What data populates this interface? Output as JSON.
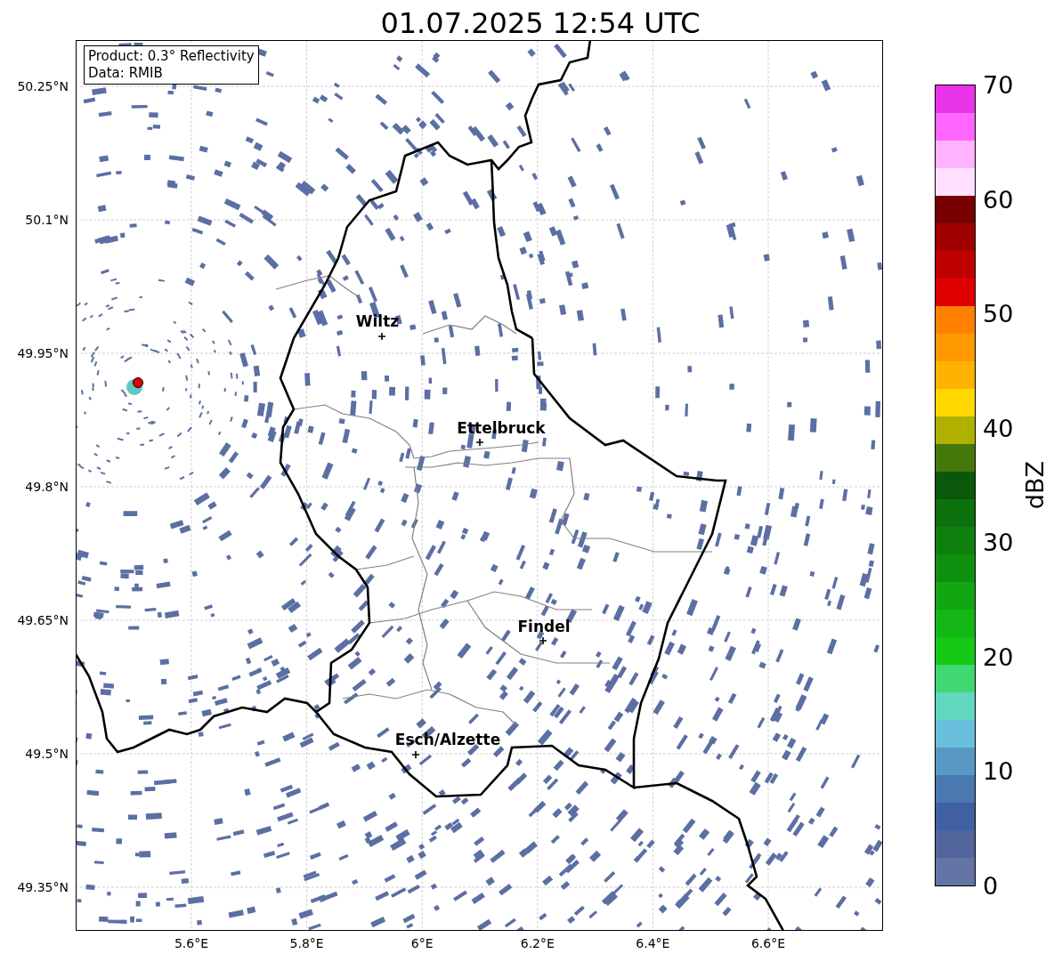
{
  "title": "01.07.2025 12:54 UTC",
  "map": {
    "info_box": [
      "Product: 0.3° Reflectivity",
      "Data: RMIB"
    ],
    "y_ticks": [
      "50.25°N",
      "50.1°N",
      "49.95°N",
      "49.8°N",
      "49.65°N",
      "49.5°N",
      "49.35°N"
    ],
    "x_ticks": [
      "5.6°E",
      "5.8°E",
      "6°E",
      "6.2°E",
      "6.4°E",
      "6.6°E"
    ],
    "places": [
      {
        "name": "Wiltz"
      },
      {
        "name": "Ettelbruck"
      },
      {
        "name": "Findel"
      },
      {
        "name": "Esch/Alzette"
      }
    ]
  },
  "colorbar": {
    "label": "dBZ",
    "ticks": [
      "70",
      "60",
      "50",
      "40",
      "30",
      "20",
      "10",
      "0"
    ],
    "segments": [
      {
        "color": "#e833e8"
      },
      {
        "color": "#ff66ff"
      },
      {
        "color": "#ffb3ff"
      },
      {
        "color": "#ffe0ff"
      },
      {
        "color": "#780000"
      },
      {
        "color": "#a00000"
      },
      {
        "color": "#c00000"
      },
      {
        "color": "#e00000"
      },
      {
        "color": "#ff8000"
      },
      {
        "color": "#ff9900"
      },
      {
        "color": "#ffb300"
      },
      {
        "color": "#ffd800"
      },
      {
        "color": "#b0b000"
      },
      {
        "color": "#447808"
      },
      {
        "color": "#0a580a"
      },
      {
        "color": "#0c700c"
      },
      {
        "color": "#0e800e"
      },
      {
        "color": "#109010"
      },
      {
        "color": "#12a612"
      },
      {
        "color": "#14b814"
      },
      {
        "color": "#14c814"
      },
      {
        "color": "#40d870"
      },
      {
        "color": "#60d8c0"
      },
      {
        "color": "#68c0dc"
      },
      {
        "color": "#5898c4"
      },
      {
        "color": "#4a78b0"
      },
      {
        "color": "#4060a4"
      },
      {
        "color": "#52659c"
      },
      {
        "color": "#6474a4"
      }
    ]
  }
}
